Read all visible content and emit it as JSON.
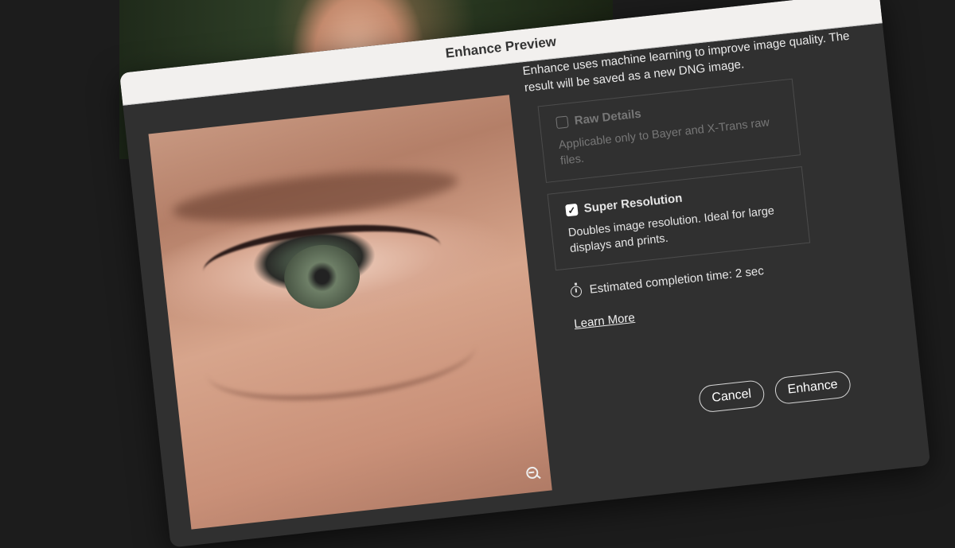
{
  "dialog": {
    "title": "Enhance Preview",
    "intro": "Enhance uses machine learning to improve image quality. The result will be saved as a new DNG image.",
    "options": [
      {
        "label": "Raw Details",
        "description": "Applicable only to Bayer and X-Trans raw files.",
        "checked": false,
        "enabled": false
      },
      {
        "label": "Super Resolution",
        "description": "Doubles image resolution. Ideal for large displays and prints.",
        "checked": true,
        "enabled": true
      }
    ],
    "estimate_text": "Estimated completion time: 2 sec",
    "learn_more": "Learn More",
    "cancel_label": "Cancel",
    "enhance_label": "Enhance"
  },
  "icons": {
    "checkmark": "✓",
    "timer": "stopwatch-icon",
    "zoom": "zoom-out-icon"
  },
  "colors": {
    "dialog_bg": "#303030",
    "titlebar_bg": "#f2f0ee",
    "page_bg": "#1c1c1c"
  }
}
